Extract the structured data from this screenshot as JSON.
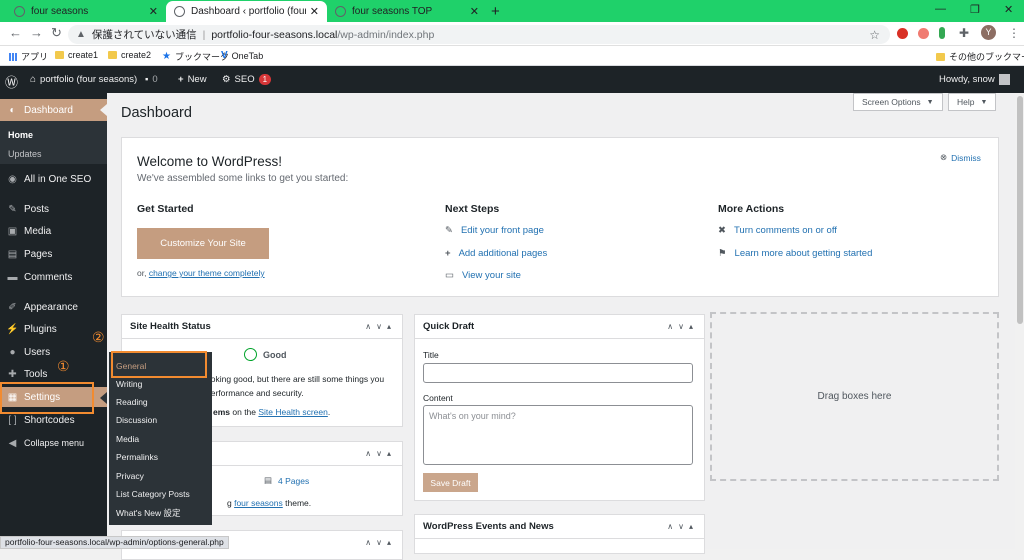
{
  "browser": {
    "tabs": [
      {
        "title": "four seasons",
        "close": "✕",
        "active": false
      },
      {
        "title": "Dashboard ‹ portfolio (four seasons) — WordPress",
        "close": "✕",
        "active": true
      },
      {
        "title": "four seasons TOP",
        "close": "✕",
        "active": false
      }
    ],
    "new_tab": "+",
    "window_controls": {
      "minimize": "—",
      "restore": "❐",
      "close": "✕"
    },
    "nav": {
      "back": "←",
      "forward": "→",
      "reload": "↻"
    },
    "address": {
      "security": "保護されていない通信",
      "host": "portfolio-four-seasons.local",
      "path": "/wp-admin/index.php"
    },
    "avatar_letter": "Y",
    "bookmarks": [
      "アプリ",
      "create1",
      "create2",
      "ブックマーク",
      "OneTab"
    ],
    "other_bookmarks": "その他のブックマーク",
    "status_url": "portfolio-four-seasons.local/wp-admin/options-general.php"
  },
  "adminbar": {
    "site": "portfolio (four seasons)",
    "comments_count": "0",
    "new": "New",
    "seo": "SEO",
    "seo_badge": "1",
    "howdy": "Howdy, snow"
  },
  "sidebar": {
    "dashboard": "Dashboard",
    "home": "Home",
    "updates": "Updates",
    "aioseo": "All in One SEO",
    "posts": "Posts",
    "media": "Media",
    "pages": "Pages",
    "comments": "Comments",
    "appearance": "Appearance",
    "plugins": "Plugins",
    "users": "Users",
    "tools": "Tools",
    "settings": "Settings",
    "shortcodes": "Shortcodes",
    "collapse": "Collapse menu"
  },
  "settings_flyout": [
    "General",
    "Writing",
    "Reading",
    "Discussion",
    "Media",
    "Permalinks",
    "Privacy",
    "List Category Posts",
    "What's New 設定"
  ],
  "annotations": {
    "one": "①",
    "two": "②"
  },
  "main": {
    "title": "Dashboard",
    "screen_options": "Screen Options",
    "help": "Help",
    "welcome": {
      "title": "Welcome to WordPress!",
      "subtitle": "We've assembled some links to get you started:",
      "dismiss": "Dismiss",
      "get_started": "Get Started",
      "customize": "Customize Your Site",
      "or": "or,",
      "change_theme": "change your theme completely",
      "next_steps": "Next Steps",
      "edit_front": "Edit your front page",
      "add_pages": "Add additional pages",
      "view_site": "View your site",
      "more_actions": "More Actions",
      "comments_toggle": "Turn comments on or off",
      "learn_more": "Learn more about getting started"
    },
    "site_health": {
      "title": "Site Health Status",
      "status": "Good",
      "line1": "ooking good, but there are still some things you",
      "line2": "performance and security.",
      "line3_bold": "ems",
      "line3_rest": " on the ",
      "line3_link": "Site Health screen",
      "line3_end": "."
    },
    "at_glance": {
      "pages": "4 Pages",
      "theme_pre": "g ",
      "theme_link": "four seasons",
      "theme_post": " theme."
    },
    "quick_draft": {
      "title": "Quick Draft",
      "title_label": "Title",
      "content_label": "Content",
      "content_placeholder": "What's on your mind?",
      "save": "Save Draft"
    },
    "events": {
      "title": "WordPress Events and News"
    },
    "drag": "Drag boxes here"
  },
  "colors": {
    "accent": "#c59d80",
    "admin_dark": "#1d2327",
    "chrome_tabbar": "#1fd16a",
    "annotation": "#f28b30"
  }
}
